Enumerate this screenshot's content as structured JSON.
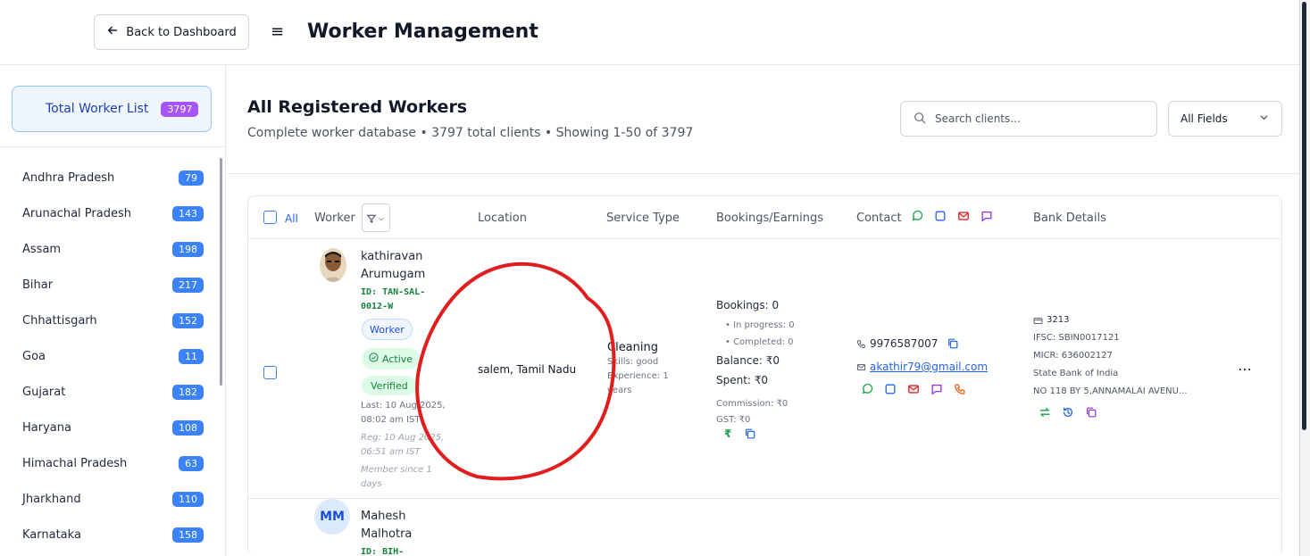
{
  "header": {
    "back_label": "Back to Dashboard",
    "title": "Worker Management"
  },
  "sidebar": {
    "total_label": "Total Worker List",
    "total_count": "3797",
    "states": [
      {
        "name": "Andhra Pradesh",
        "count": "79"
      },
      {
        "name": "Arunachal Pradesh",
        "count": "143"
      },
      {
        "name": "Assam",
        "count": "198"
      },
      {
        "name": "Bihar",
        "count": "217"
      },
      {
        "name": "Chhattisgarh",
        "count": "152"
      },
      {
        "name": "Goa",
        "count": "11"
      },
      {
        "name": "Gujarat",
        "count": "182"
      },
      {
        "name": "Haryana",
        "count": "108"
      },
      {
        "name": "Himachal Pradesh",
        "count": "63"
      },
      {
        "name": "Jharkhand",
        "count": "110"
      },
      {
        "name": "Karnataka",
        "count": "158"
      }
    ]
  },
  "main": {
    "title": "All Registered Workers",
    "subtitle": "Complete worker database • 3797 total clients • Showing 1-50 of 3797",
    "search_placeholder": "Search clients...",
    "field_filter": "All Fields"
  },
  "table": {
    "columns": {
      "all": "All",
      "worker": "Worker",
      "location": "Location",
      "service": "Service Type",
      "bookings": "Bookings/Earnings",
      "contact": "Contact",
      "bank": "Bank Details"
    },
    "rows": [
      {
        "name": "kathiravan Arumugam",
        "id": "ID: TAN-SAL-0012-W",
        "role": "Worker",
        "status": "Active",
        "verification": "Verified",
        "last": "Last: 10 Aug 2025, 08:02 am IST",
        "reg": "Reg: 10 Aug 2025, 06:51 am IST",
        "member": "Member since 1 days",
        "location": "salem, Tamil Nadu",
        "service": "Cleaning",
        "skills": "Skills: good",
        "experience": "Experience: 1 years",
        "bookings": "Bookings: 0",
        "in_progress": "• In progress: 0",
        "completed": "• Completed: 0",
        "balance": "Balance: ₹0",
        "spent": "Spent: ₹0",
        "commission": "Commission: ₹0",
        "gst": "GST: ₹0",
        "phone": "9976587007",
        "email": "akathir79@gmail.com",
        "account": "3213",
        "ifsc": "IFSC: SBIN0017121",
        "micr": "MICR: 636002127",
        "bank_name": "State Bank of India",
        "address": "NO 118 BY 5,ANNAMALAI AVENU..."
      },
      {
        "initials": "MM",
        "name": "Mahesh Malhotra",
        "id": "ID: BIH-"
      }
    ]
  },
  "colors": {
    "primary": "#3b82f6",
    "purple_badge": "#a855f7",
    "success": "#15803d",
    "annotation": "#e11d1d"
  }
}
